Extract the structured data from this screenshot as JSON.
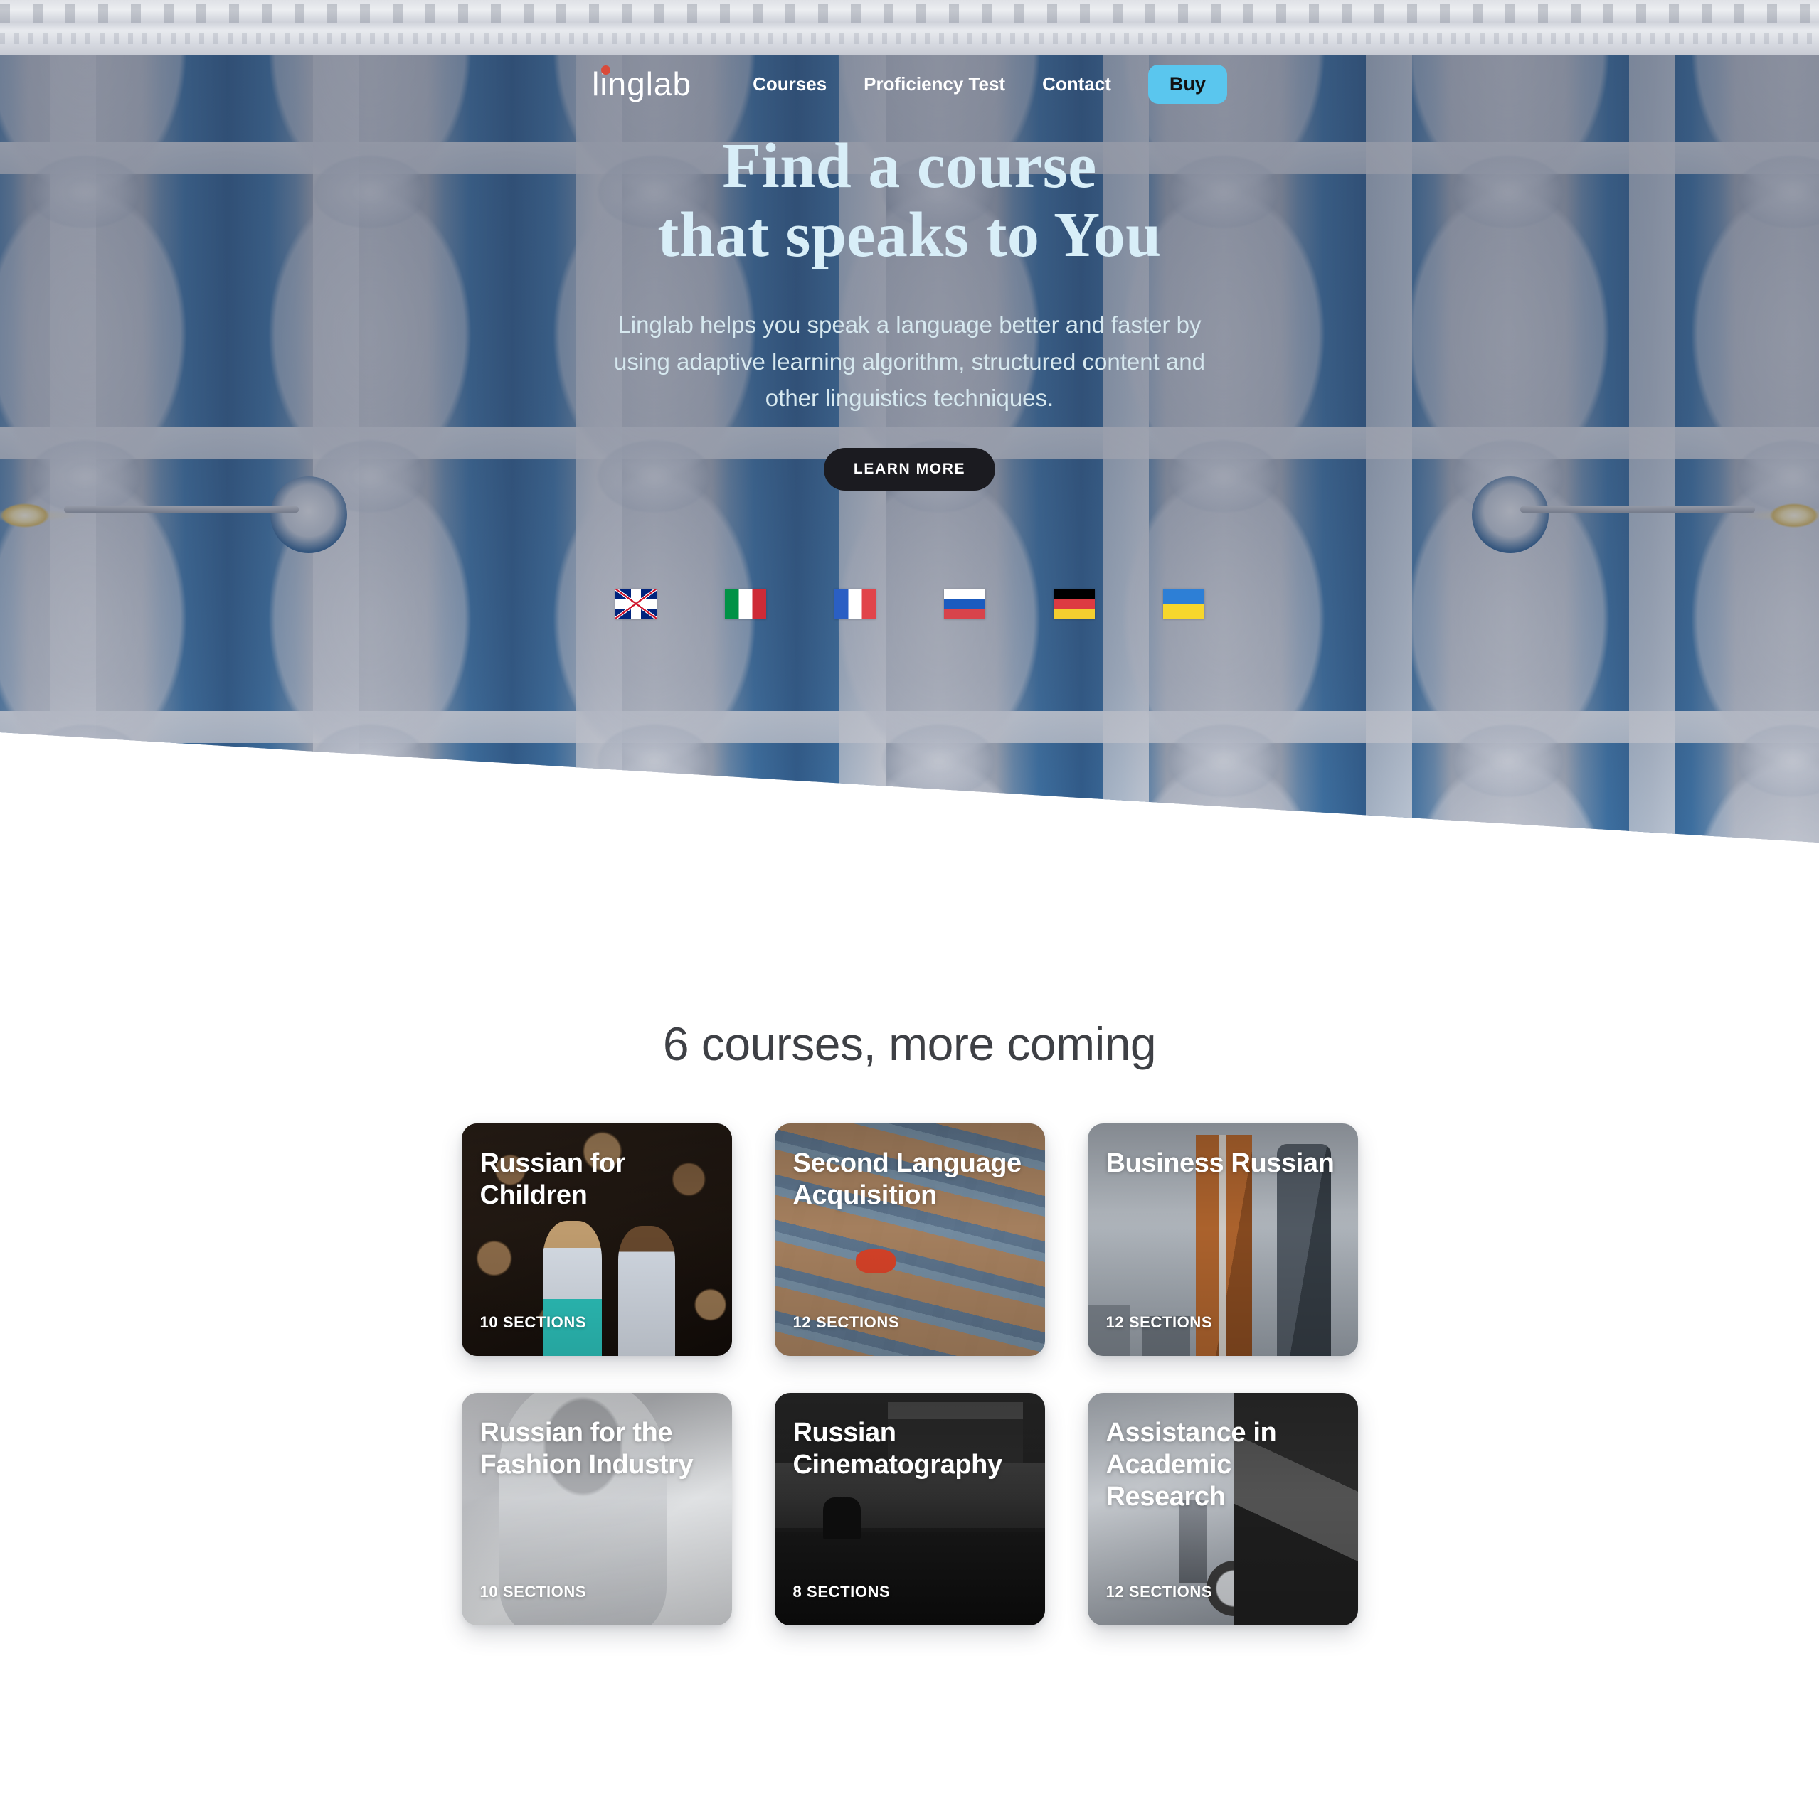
{
  "brand": {
    "name": "linglab",
    "dot_color": "#d94b3a"
  },
  "nav": {
    "links": [
      {
        "label": "Courses"
      },
      {
        "label": "Proficiency Test"
      },
      {
        "label": "Contact"
      }
    ],
    "buy_label": "Buy",
    "buy_color": "#5ac6ee"
  },
  "hero": {
    "title_line1": "Find a course",
    "title_line2": "that speaks to You",
    "title_color": "#d8eef8",
    "subtitle": "Linglab helps you speak a language better and faster by using adaptive learning algorithm, structured content and other linguistics techniques.",
    "cta_label": "LEARN MORE",
    "flags": [
      {
        "name": "flag-united-kingdom",
        "code": "uk"
      },
      {
        "name": "flag-italy",
        "code": "it"
      },
      {
        "name": "flag-france",
        "code": "fr"
      },
      {
        "name": "flag-russia",
        "code": "ru"
      },
      {
        "name": "flag-germany",
        "code": "de"
      },
      {
        "name": "flag-ukraine",
        "code": "ua"
      }
    ]
  },
  "courses": {
    "heading": "6 courses, more coming",
    "items": [
      {
        "title": "Russian for Children",
        "sections": "10 SECTIONS"
      },
      {
        "title": "Second Language Acquisition",
        "sections": "12 SECTIONS"
      },
      {
        "title": "Business Russian",
        "sections": "12 SECTIONS"
      },
      {
        "title": "Russian for the Fashion Industry",
        "sections": "10 SECTIONS"
      },
      {
        "title": "Russian Cinematography",
        "sections": "8 SECTIONS"
      },
      {
        "title": "Assistance in Academic Research",
        "sections": "12 SECTIONS"
      }
    ]
  }
}
